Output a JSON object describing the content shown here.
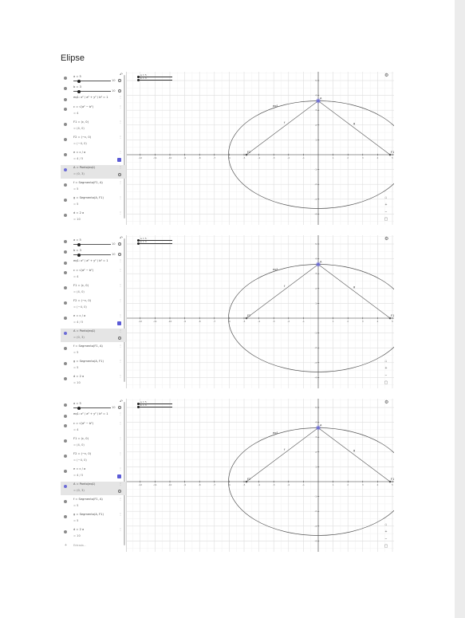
{
  "document": {
    "title": "Elipse"
  },
  "colors": {
    "accent": "#6b6bd6",
    "grid_minor": "#efefef",
    "grid_major": "#dcdcdc",
    "axis": "#444444"
  },
  "panels": [
    {
      "algebra": [
        {
          "type": "slider",
          "label": "a = 5",
          "min": "0",
          "max": "10"
        },
        {
          "type": "slider",
          "label": "b = 3",
          "min": "0",
          "max": "10"
        },
        {
          "type": "expr",
          "label": "eq1: x² / a² + y² / b² = 1",
          "value": ""
        },
        {
          "type": "expr",
          "label": "c = √(a² − b²)",
          "value": "= 4"
        },
        {
          "type": "expr",
          "label": "F1 = (c, 0)",
          "value": "= (4, 0)"
        },
        {
          "type": "expr",
          "label": "F2 = (−c, 0)",
          "value": "= (−4, 0)"
        },
        {
          "type": "check",
          "label": "e = c / a",
          "value": "= 4 / 5"
        },
        {
          "type": "point",
          "label": "A = Ponto(eq1)",
          "value": "= (0, 3)",
          "selected": true
        },
        {
          "type": "expr",
          "label": "f = Segmento(F1, A)",
          "value": "= 5"
        },
        {
          "type": "expr",
          "label": "g = Segmento(A, F1)",
          "value": "= 5"
        },
        {
          "type": "expr",
          "label": "d = 2 a",
          "value": "= 10"
        }
      ],
      "graph_labels": {
        "eq1": "eq1",
        "f": "f",
        "g": "g",
        "A": "A",
        "F1": "F1",
        "F2": "F2"
      },
      "top_sliders": [
        "a = 5",
        "b = 3"
      ]
    },
    {
      "algebra": [
        {
          "type": "slider",
          "label": "a = 5",
          "min": "0",
          "max": "10"
        },
        {
          "type": "slider",
          "label": "b = 3",
          "min": "0",
          "max": "10"
        },
        {
          "type": "expr",
          "label": "eq1: x² / a² + y² / b² = 1",
          "value": ""
        },
        {
          "type": "expr",
          "label": "c = √(a² − b²)",
          "value": "= 4"
        },
        {
          "type": "expr",
          "label": "F1 = (c, 0)",
          "value": "= (4, 0)"
        },
        {
          "type": "expr",
          "label": "F2 = (−c, 0)",
          "value": "= (−4, 0)"
        },
        {
          "type": "check",
          "label": "e = c / a",
          "value": "= 4 / 5"
        },
        {
          "type": "point",
          "label": "A = Ponto(eq1)",
          "value": "= (0, 3)",
          "selected": true
        },
        {
          "type": "expr",
          "label": "f = Segmento(F1, A)",
          "value": "= 5"
        },
        {
          "type": "expr",
          "label": "g = Segmento(A, F1)",
          "value": "= 5"
        },
        {
          "type": "expr",
          "label": "d = 2 a",
          "value": "= 10"
        }
      ],
      "graph_labels": {
        "eq1": "eq1",
        "f": "f",
        "g": "g",
        "A": "A",
        "F1": "F1",
        "F2": "F2"
      },
      "top_sliders": [
        "a = 5",
        "b = 3"
      ]
    },
    {
      "algebra": [
        {
          "type": "slider",
          "label": "a = 5",
          "min": "0",
          "max": "10"
        },
        {
          "type": "expr",
          "label": "eq1: x² / a² + y² / b² = 1",
          "value": ""
        },
        {
          "type": "expr",
          "label": "c = √(a² − b²)",
          "value": "= 4"
        },
        {
          "type": "expr",
          "label": "F1 = (c, 0)",
          "value": "= (4, 0)"
        },
        {
          "type": "expr",
          "label": "F2 = (−c, 0)",
          "value": "= (−4, 0)"
        },
        {
          "type": "check",
          "label": "e = c / a",
          "value": "= 4 / 5"
        },
        {
          "type": "point",
          "label": "A = Ponto(eq1)",
          "value": "= (0, 3)",
          "selected": true
        },
        {
          "type": "expr",
          "label": "f = Segmento(F1, A)",
          "value": "= 5"
        },
        {
          "type": "expr",
          "label": "g = Segmento(A, F1)",
          "value": "= 5"
        },
        {
          "type": "expr",
          "label": "d = 2 a",
          "value": "= 10"
        }
      ],
      "input_placeholder": "Entrada...",
      "graph_labels": {
        "eq1": "eq1",
        "f": "f",
        "g": "g",
        "A": "A",
        "F1": "F1",
        "F2": "F2"
      },
      "top_sliders": [
        "a = 5",
        "b = 3"
      ]
    }
  ]
}
